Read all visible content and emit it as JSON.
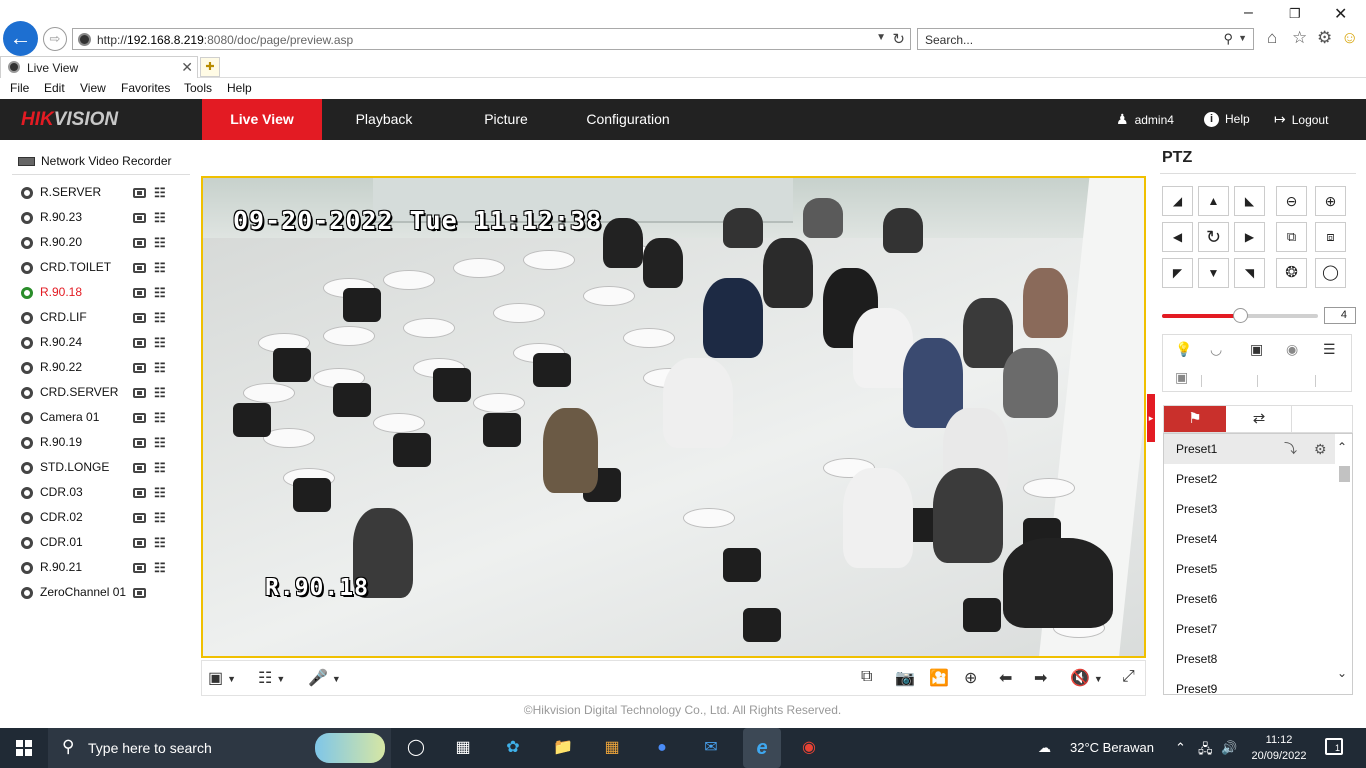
{
  "browser": {
    "url_prefix": "http://",
    "url_host": "192.168.8.219",
    "url_rest": ":8080/doc/page/preview.asp",
    "search_placeholder": "Search...",
    "tab_title": "Live View",
    "menu": [
      "File",
      "Edit",
      "View",
      "Favorites",
      "Tools",
      "Help"
    ]
  },
  "app": {
    "brand_hik": "HIK",
    "brand_vision": "VISION",
    "nav": [
      "Live View",
      "Playback",
      "Picture",
      "Configuration"
    ],
    "active_nav": "Live View",
    "user": "admin4",
    "help": "Help",
    "logout": "Logout"
  },
  "tree": {
    "root": "Network Video Recorder",
    "cameras": [
      {
        "name": "R.SERVER",
        "recording": false,
        "active": false
      },
      {
        "name": "R.90.23",
        "recording": false,
        "active": false
      },
      {
        "name": "R.90.20",
        "recording": false,
        "active": false
      },
      {
        "name": "CRD.TOILET",
        "recording": false,
        "active": false
      },
      {
        "name": "R.90.18",
        "recording": true,
        "active": true
      },
      {
        "name": "CRD.LIF",
        "recording": false,
        "active": false
      },
      {
        "name": "R.90.24",
        "recording": false,
        "active": false
      },
      {
        "name": "R.90.22",
        "recording": false,
        "active": false
      },
      {
        "name": "CRD.SERVER",
        "recording": false,
        "active": false
      },
      {
        "name": "Camera 01",
        "recording": false,
        "active": false
      },
      {
        "name": "R.90.19",
        "recording": false,
        "active": false
      },
      {
        "name": "STD.LONGE",
        "recording": false,
        "active": false
      },
      {
        "name": "CDR.03",
        "recording": false,
        "active": false
      },
      {
        "name": "CDR.02",
        "recording": false,
        "active": false
      },
      {
        "name": "CDR.01",
        "recording": false,
        "active": false
      },
      {
        "name": "R.90.21",
        "recording": false,
        "active": false
      },
      {
        "name": "ZeroChannel 01",
        "recording": false,
        "active": false
      }
    ]
  },
  "video": {
    "osd_timestamp": "09-20-2022 Tue 11:12:38",
    "osd_camera": "R.90.18"
  },
  "footer": {
    "copyright": "©Hikvision Digital Technology Co., Ltd. All Rights Reserved."
  },
  "ptz": {
    "title": "PTZ",
    "speed": 4,
    "speed_max": 7,
    "presets": [
      "Preset1",
      "Preset2",
      "Preset3",
      "Preset4",
      "Preset5",
      "Preset6",
      "Preset7",
      "Preset8",
      "Preset9"
    ],
    "selected_preset": "Preset1"
  },
  "taskbar": {
    "search_placeholder": "Type here to search",
    "weather": "32°C  Berawan",
    "time": "11:12",
    "date": "20/09/2022",
    "notifications": "1"
  },
  "colors": {
    "brand_red": "#e31b23",
    "topbar": "#222222",
    "osd_border": "#f0c000",
    "taskbar": "#202a35"
  }
}
